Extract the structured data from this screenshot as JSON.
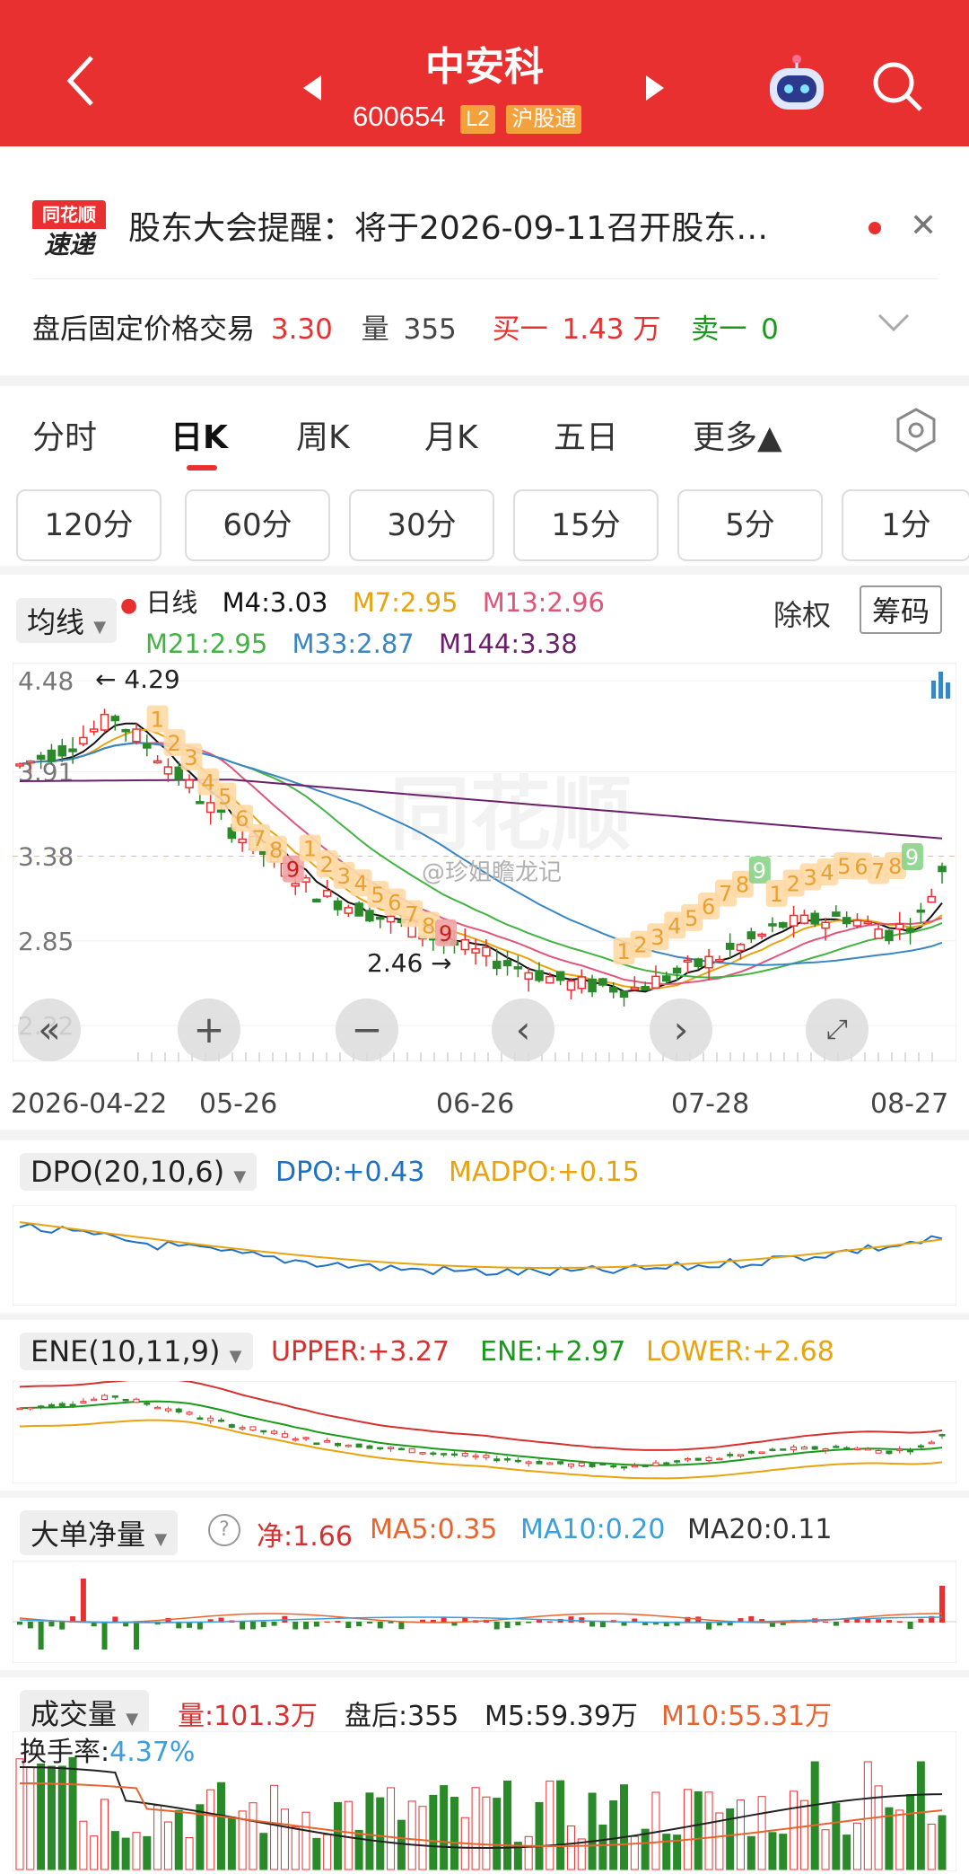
{
  "header": {
    "title": "中安科",
    "code": "600654",
    "badge_l2": "L2",
    "badge_market": "沪股通"
  },
  "notice": {
    "logo_top": "同花顺",
    "logo_bottom": "速递",
    "text": "股东大会提醒：将于2026-09-11召开股东…",
    "after_label": "盘后固定价格交易",
    "after_price": "3.30",
    "vol_label": "量",
    "vol_value": "355",
    "buy_label": "买一",
    "buy_value": "1.43 万",
    "sell_label": "卖一",
    "sell_value": "0"
  },
  "tabs": {
    "items": [
      "分时",
      "日K",
      "周K",
      "月K",
      "五日",
      "更多▲"
    ],
    "periods": [
      "120分",
      "60分",
      "30分",
      "15分",
      "5分",
      "1分"
    ]
  },
  "kline": {
    "ma_selector": "均线",
    "ma_title": "日线",
    "m4": "M4:3.03",
    "m7": "M7:2.95",
    "m13": "M13:2.96",
    "m21": "M21:2.95",
    "m33": "M33:2.87",
    "m144": "M144:3.38",
    "fq": "除权",
    "chip": "筹码",
    "y_labels": [
      "4.48",
      "3.91",
      "3.38",
      "2.85",
      "2.32"
    ],
    "high_mark": "4.29",
    "low_mark": "2.46",
    "x_labels": [
      "2026-04-22",
      "05-26",
      "06-26",
      "07-28",
      "08-27"
    ],
    "watermark": "同花顺",
    "weibo": "@珍姐瞻龙记",
    "seq_left": [
      "1",
      "2",
      "3",
      "4",
      "5",
      "6",
      "7",
      "8",
      "9",
      "1",
      "2",
      "3",
      "4",
      "5",
      "6",
      "7",
      "8",
      "9"
    ],
    "seq_right": [
      "1",
      "2",
      "3",
      "4",
      "5",
      "6",
      "7",
      "8",
      "9",
      "1",
      "2",
      "3",
      "4",
      "5",
      "6",
      "7",
      "8",
      "9"
    ],
    "colors": {
      "up": "#e93030",
      "down": "#2a8a2a",
      "m4": "#111111",
      "m7": "#e8a30e",
      "m13": "#e0557a",
      "m21": "#43b343",
      "m33": "#3a86c4",
      "m144": "#6b1f6b"
    }
  },
  "dpo": {
    "selector": "DPO(20,10,6)",
    "dpo": "DPO:+0.43",
    "madpo": "MADPO:+0.15"
  },
  "ene": {
    "selector": "ENE(10,11,9)",
    "upper": "UPPER:+3.27",
    "ene": "ENE:+2.97",
    "lower": "LOWER:+2.68"
  },
  "bigorder": {
    "selector": "大单净量",
    "net": "净:1.66",
    "ma5": "MA5:0.35",
    "ma10": "MA10:0.20",
    "ma20": "MA20:0.11"
  },
  "volume": {
    "selector": "成交量",
    "vol": "量:101.3万",
    "after": "盘后:355",
    "m5": "M5:59.39万",
    "m10": "M10:55.31万",
    "turnover_label": "换手率:",
    "turnover": "4.37%"
  }
}
